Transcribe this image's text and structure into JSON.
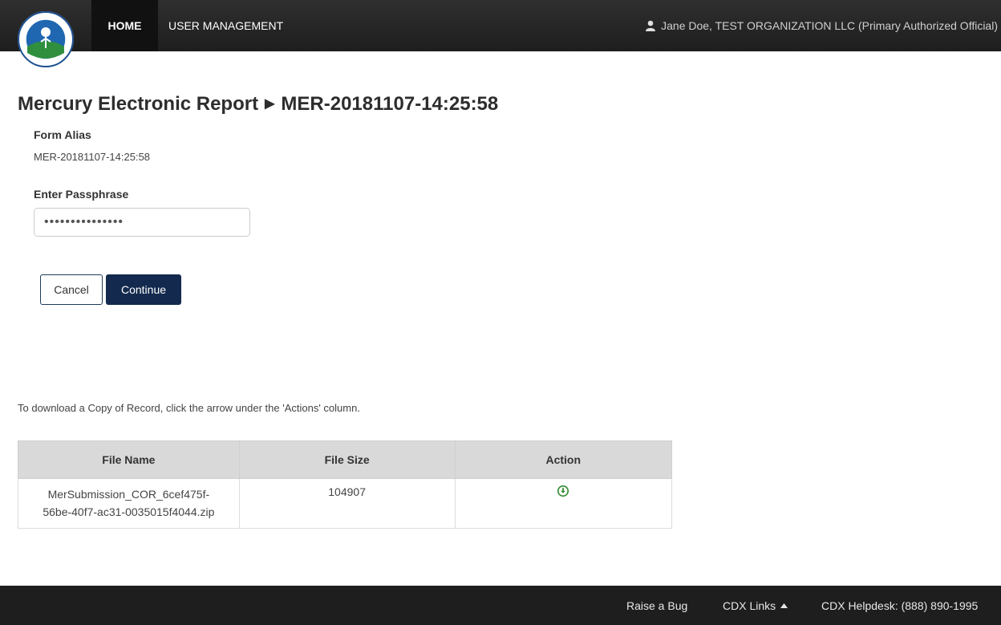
{
  "header": {
    "nav": {
      "home": "HOME",
      "user_management": "USER MANAGEMENT"
    },
    "user": {
      "display": "Jane Doe, TEST ORGANIZATION LLC (Primary Authorized Official)",
      "icon": "user-icon"
    },
    "logo_icon": "epa-seal-icon"
  },
  "page": {
    "title": "Mercury Electronic Report",
    "breadcrumb_sep": "▶",
    "record_id": "MER-20181107-14:25:58"
  },
  "form": {
    "alias_label": "Form Alias",
    "alias_value": "MER-20181107-14:25:58",
    "passphrase_label": "Enter Passphrase",
    "passphrase_value": "•••••••••••••••"
  },
  "buttons": {
    "cancel": "Cancel",
    "continue": "Continue"
  },
  "instructions": "To download a Copy of Record, click the arrow under the 'Actions' column.",
  "table": {
    "headers": [
      "File Name",
      "File Size",
      "Action"
    ],
    "rows": [
      {
        "file_name_line1": "MerSubmission_COR_6cef475f-",
        "file_name_line2": "56be-40f7-ac31-0035015f4044.zip",
        "file_size": "104907",
        "action_icon": "download-arrow-icon"
      }
    ]
  },
  "footer": {
    "raise_bug": "Raise a Bug",
    "cdx_links": "CDX Links",
    "cdx_links_icon": "caret-up-icon",
    "helpdesk": "CDX Helpdesk: (888) 890-1995"
  },
  "colors": {
    "navbar": "#2b2b2b",
    "nav_active": "#111111",
    "primary_button": "#132a4e",
    "download_icon": "#2e8b2e",
    "table_header": "#d9d9d9",
    "footer": "#1e1e1e"
  }
}
